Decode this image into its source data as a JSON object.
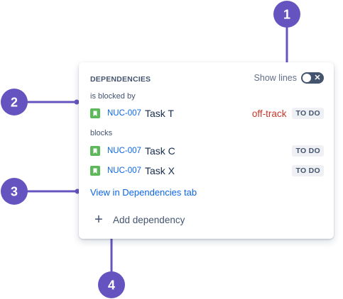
{
  "panel": {
    "heading": "DEPENDENCIES",
    "show_lines_label": "Show lines",
    "toggle_icon": "x-icon",
    "sections": {
      "blocked_by_label": "is blocked by",
      "blocks_label": "blocks"
    },
    "items": [
      {
        "key": "NUC-007",
        "title": "Task T",
        "flag": "off-track",
        "status": "TO DO",
        "icon": "story-bookmark-icon"
      },
      {
        "key": "NUC-007",
        "title": "Task C",
        "status": "TO DO",
        "icon": "story-bookmark-icon"
      },
      {
        "key": "NUC-007",
        "title": "Task X",
        "status": "TO DO",
        "icon": "story-bookmark-icon"
      }
    ],
    "link_label": "View in Dependencies tab",
    "add_label": "Add dependency"
  },
  "callouts": [
    "1",
    "2",
    "3",
    "4"
  ],
  "colors": {
    "callout": "#6554c0",
    "link": "#0c66e4",
    "offtrack": "#c9372c",
    "story_icon": "#5db85a"
  }
}
